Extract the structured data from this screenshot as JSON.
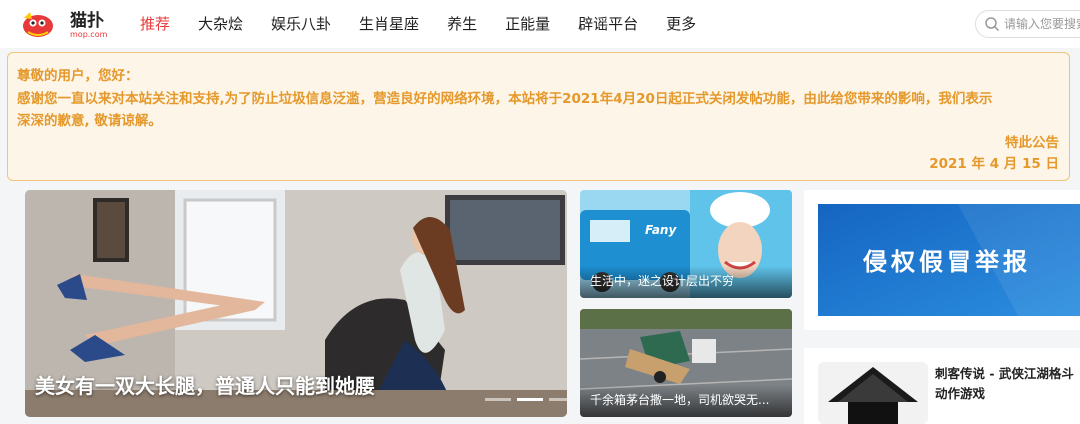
{
  "header": {
    "logo_text": "猫扑",
    "logo_sub": "mop.com",
    "nav": [
      {
        "label": "推荐",
        "active": true
      },
      {
        "label": "大杂烩",
        "active": false
      },
      {
        "label": "娱乐八卦",
        "active": false
      },
      {
        "label": "生肖星座",
        "active": false
      },
      {
        "label": "养生",
        "active": false
      },
      {
        "label": "正能量",
        "active": false
      },
      {
        "label": "辟谣平台",
        "active": false
      },
      {
        "label": "更多",
        "active": false
      }
    ],
    "search_placeholder": "请输入您要搜索",
    "search_icon": "search-icon"
  },
  "notice": {
    "greeting": "尊敬的用户，您好：",
    "body_line1": "感谢您一直以来对本站关注和支持,为了防止垃圾信息泛滥，营造良好的网络环境，本站将于2021年4月20日起正式关闭发帖功能，由此给您带来的影响，我们表示",
    "body_line2": "深深的歉意, 敬请谅解。",
    "signature": "特此公告",
    "date": "2021 年 4 月 15 日"
  },
  "feature": {
    "caption": "美女有一双大长腿，普通人只能到她腰",
    "slide_count": 3,
    "active_slide": 1
  },
  "thumbs": [
    {
      "caption": "生活中，迷之设计层出不穷"
    },
    {
      "caption": "千余箱茅台撒一地，司机欲哭无..."
    }
  ],
  "sidebar": {
    "banner_text": "侵权假冒举报",
    "game_title": "刺客传说 - 武侠江湖格斗动作游戏"
  },
  "colors": {
    "accent": "#e8393a",
    "notice_text": "#e5982b",
    "notice_bg": "#fdf6e8",
    "banner_blue": "#1e7fd8"
  }
}
